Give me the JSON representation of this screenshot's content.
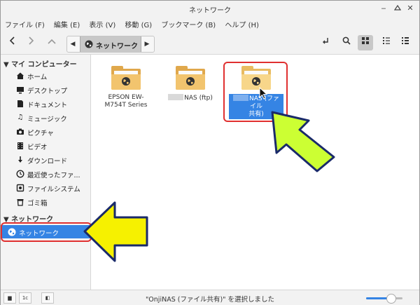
{
  "window": {
    "title": "ネットワーク"
  },
  "menu": [
    "ファイル (F)",
    "編集 (E)",
    "表示 (V)",
    "移動 (G)",
    "ブックマーク (B)",
    "ヘルプ (H)"
  ],
  "toolbar": {
    "location": "ネットワーク"
  },
  "sidebar": {
    "section_computer": "マイ コンピューター",
    "items": [
      {
        "label": "ホーム",
        "icon": "home-icon"
      },
      {
        "label": "デスクトップ",
        "icon": "desktop-icon"
      },
      {
        "label": "ドキュメント",
        "icon": "document-icon"
      },
      {
        "label": "ミュージック",
        "icon": "music-icon"
      },
      {
        "label": "ピクチャ",
        "icon": "camera-icon"
      },
      {
        "label": "ビデオ",
        "icon": "video-icon"
      },
      {
        "label": "ダウンロード",
        "icon": "download-icon"
      },
      {
        "label": "最近使ったファ...",
        "icon": "clock-icon"
      },
      {
        "label": "ファイルシステム",
        "icon": "drive-icon"
      },
      {
        "label": "ゴミ箱",
        "icon": "trash-icon"
      }
    ],
    "section_network": "ネットワーク",
    "network_item": "ネットワーク"
  },
  "files": [
    {
      "line1": "EPSON EW-",
      "line2": "M754T Series"
    },
    {
      "line1": "NAS (ftp)",
      "line2": ""
    },
    {
      "line1": "NAS (ファイル",
      "line2": "共有)"
    }
  ],
  "status": {
    "text": "\"OnjiNAS (ファイル共有)\" を選択しました",
    "zoom_fraction": 0.7
  },
  "colors": {
    "selection": "#3584e4",
    "annotation_arrow": "#f6f100",
    "annotation_arrow_green": "#ccff33",
    "annotation_box": "#e03030"
  }
}
